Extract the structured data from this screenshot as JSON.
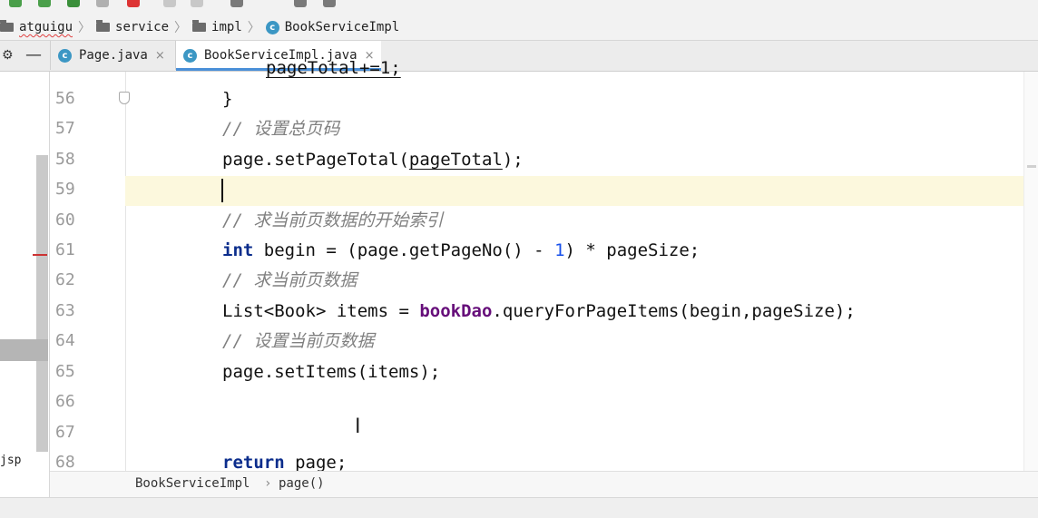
{
  "breadcrumb": [
    {
      "icon": "folder-icon",
      "label": "atguigu"
    },
    {
      "icon": "folder-icon",
      "label": "service"
    },
    {
      "icon": "folder-icon",
      "label": "impl"
    },
    {
      "icon": "class-icon",
      "label": "BookServiceImpl"
    }
  ],
  "tabs": [
    {
      "label": "Page.java",
      "active": false
    },
    {
      "label": "BookServiceImpl.java",
      "active": true
    }
  ],
  "class_icon_letter": "c",
  "tab_close": "×",
  "sidebar": {
    "jsp_label": "jsp"
  },
  "editor": {
    "partial_top_line": "pageTotal+=1;",
    "lines": [
      {
        "num": "56",
        "text": "}"
      },
      {
        "num": "57",
        "text": "// 设置总页码"
      },
      {
        "num": "58",
        "text": "page.setPageTotal(pageTotal);"
      },
      {
        "num": "59",
        "text": ""
      },
      {
        "num": "60",
        "text": "// 求当前页数据的开始索引"
      },
      {
        "num": "61",
        "text": "int begin = (page.getPageNo() - 1) * pageSize;"
      },
      {
        "num": "62",
        "text": "// 求当前页数据"
      },
      {
        "num": "63",
        "text": "List<Book> items = bookDao.queryForPageItems(begin,pageSize);"
      },
      {
        "num": "64",
        "text": "// 设置当前页数据"
      },
      {
        "num": "65",
        "text": "page.setItems(items);"
      },
      {
        "num": "66",
        "text": ""
      },
      {
        "num": "67",
        "text": ""
      },
      {
        "num": "68",
        "text": "return page;"
      }
    ],
    "current_line": "59"
  },
  "editor_breadcrumb": {
    "class": "BookServiceImpl",
    "separator": "›",
    "method": "page()"
  },
  "colors": {
    "keyword": "#0b2d8c",
    "comment": "#808080",
    "field": "#660e7a",
    "number": "#1750eb",
    "current_line_bg": "#fcf8dd",
    "class_icon": "#3c97c4"
  }
}
